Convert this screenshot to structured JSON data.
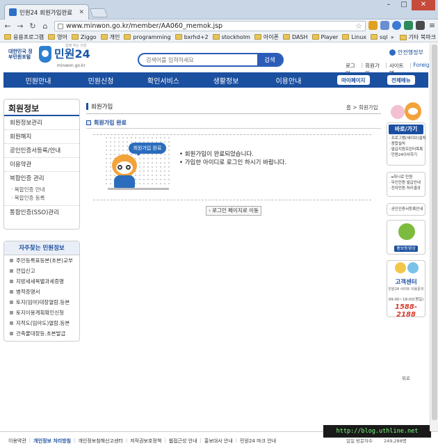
{
  "browser": {
    "tab_title": "민원24 회원가입완료",
    "url": "www.minwon.go.kr/member/AA060_memok.jsp",
    "bookmarks": [
      "응용프로그램",
      "영어",
      "Ziggo",
      "개인",
      "programming",
      "bxrhd+2",
      "stockholm",
      "아이폰",
      "DASH",
      "Player",
      "Linux",
      "sql"
    ],
    "bookmarks_more": "»",
    "other_bookmarks": "기타 북마크"
  },
  "site": {
    "gov_label": "대한민국 정부민원포털",
    "tagline": "함께 여는 민원",
    "brand": "민원24",
    "domain": "minwon.go.kr",
    "search_placeholder": "검색어를 입력하세요",
    "search_button": "검색",
    "ministry": "안전행정부",
    "util": {
      "login": "로그인",
      "join": "회원가입",
      "sitemap": "사이트맵",
      "foreigner": "Foreigner"
    },
    "nav": [
      "민원안내",
      "민원신청",
      "확인서비스",
      "생활정보",
      "이용안내"
    ],
    "mypage": "마이페이지",
    "all_menu": "전체메뉴"
  },
  "sidebar": {
    "title": "회원정보",
    "items": [
      "회원정보관리",
      "회원해지",
      "공인인증서등록/안내",
      "이용약관",
      "복합인증 관리"
    ],
    "subitems": [
      "복합인증 안내",
      "복합인증 등록"
    ],
    "sso": "통합인증(SSO)관리"
  },
  "favorites": {
    "title": "자주찾는 민원정보",
    "items": [
      "주민등록표등본(초본)교부",
      "전입신고",
      "지방세세목별과세증명",
      "병적증명서",
      "토지(임야)대장열람.등본",
      "토지이용계획확인신청",
      "지적도(임야도)열람.등본",
      "건축물대장등.초본발급"
    ]
  },
  "content": {
    "page_title": "회원가입",
    "breadcrumb_home": "홈",
    "breadcrumb_sep": ">",
    "breadcrumb_current": "회원가입",
    "section_title": "회원가입 완료",
    "bubble": "회원가입 완료",
    "messages": [
      "• 회원가입이 완료되었습니다.",
      "• 가입한 아이디로 로그인 하시기 바랍니다."
    ],
    "login_button": "로그인 페이지로 이동"
  },
  "right_rail": {
    "shortcut_title": "바로/가기",
    "shortcuts": [
      "프로그램(세이브)설치",
      "종합설치",
      "발급지원프린터목록",
      "민원24이사하기"
    ],
    "group2": [
      "e하나로 민원",
      "무인민원 발급안내",
      "전자민원 처리결과"
    ],
    "group3": [
      "공인인증서등록안내"
    ],
    "promo": "홍보동영상",
    "center_title": "고객센터",
    "center_sub": "민원24 사이트 이용문의",
    "hours": "09:00~18:00(평일)",
    "phone": "1588-2188",
    "top": "위로"
  },
  "footer": {
    "links": [
      "이용약관",
      "개인정보 처리방침",
      "개인정보침해신고센터",
      "저작권보호정책",
      "웹접근성 안내",
      "홍보대사 안내",
      "민원24 마크 안내"
    ],
    "watermark": "http://blog.uthline.net",
    "visitor_label": "일일 방문자수",
    "visitor_count": "249,288명"
  }
}
